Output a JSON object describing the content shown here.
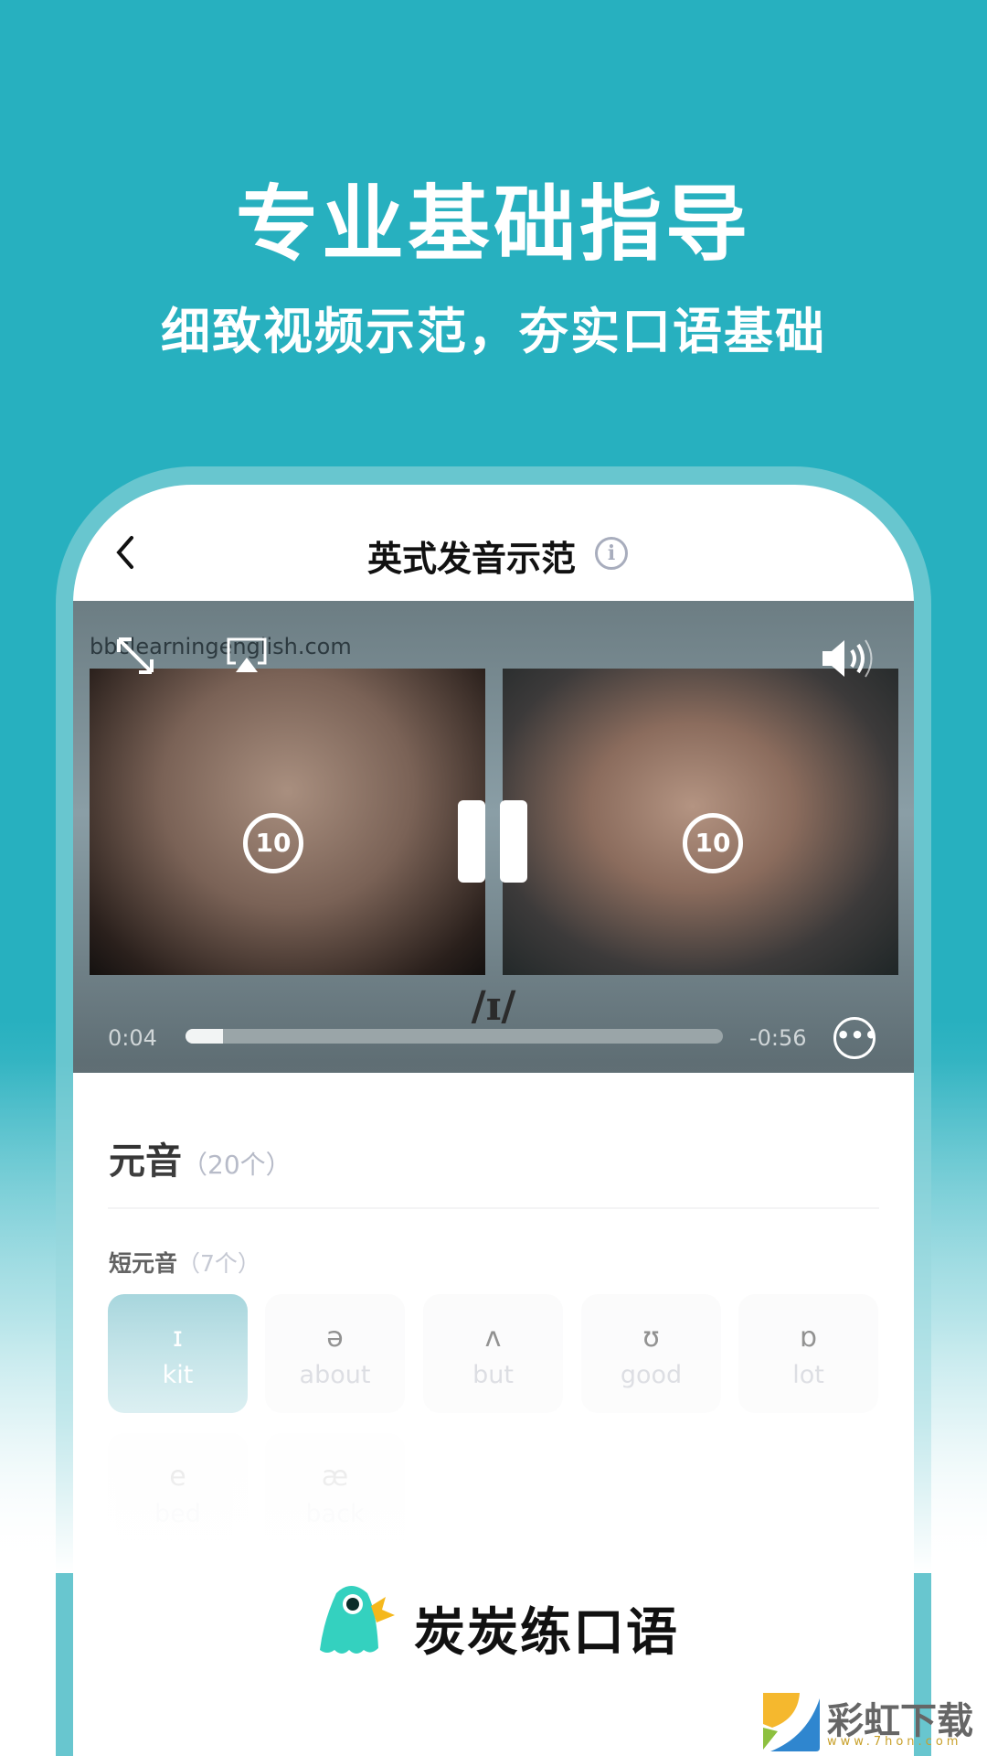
{
  "promo": {
    "headline": "专业基础指导",
    "subline": "细致视频示范，夯实口语基础"
  },
  "header": {
    "back_icon": "chevron-left-icon",
    "title": "英式发音示范",
    "info_icon": "info-icon",
    "info_glyph": "i"
  },
  "video": {
    "watermark": "bbclearningenglish.com",
    "phoneme": "/ɪ/",
    "current_time": "0:04",
    "remaining_time": "-0:56",
    "progress_percent": 7,
    "replay_left_label": "10",
    "replay_right_label": "10",
    "more_glyph": "•••",
    "icons": [
      "expand-icon",
      "airplay-icon",
      "volume-icon",
      "replay-10-icon",
      "pause-icon",
      "forward-10-icon",
      "more-icon"
    ]
  },
  "section": {
    "title": "元音",
    "count": "（20个）"
  },
  "subsection": {
    "title": "短元音",
    "count": "（7个）"
  },
  "vowels": [
    {
      "symbol": "ɪ",
      "word": "kit",
      "selected": true
    },
    {
      "symbol": "ə",
      "word": "about"
    },
    {
      "symbol": "ʌ",
      "word": "but"
    },
    {
      "symbol": "ʊ",
      "word": "good"
    },
    {
      "symbol": "ɒ",
      "word": "lot"
    },
    {
      "symbol": "e",
      "word": "bed"
    },
    {
      "symbol": "æ",
      "word": "back"
    }
  ],
  "brand": {
    "name": "炭炭练口语"
  },
  "site_watermark": {
    "name": "彩虹下载",
    "url": "www.7hon.com"
  },
  "colors": {
    "background": "#27b0bf",
    "frame": "#68c6cf",
    "selected_card": "#6fbcc7",
    "mascot": "#34d1bf",
    "beak": "#f5b81c"
  }
}
